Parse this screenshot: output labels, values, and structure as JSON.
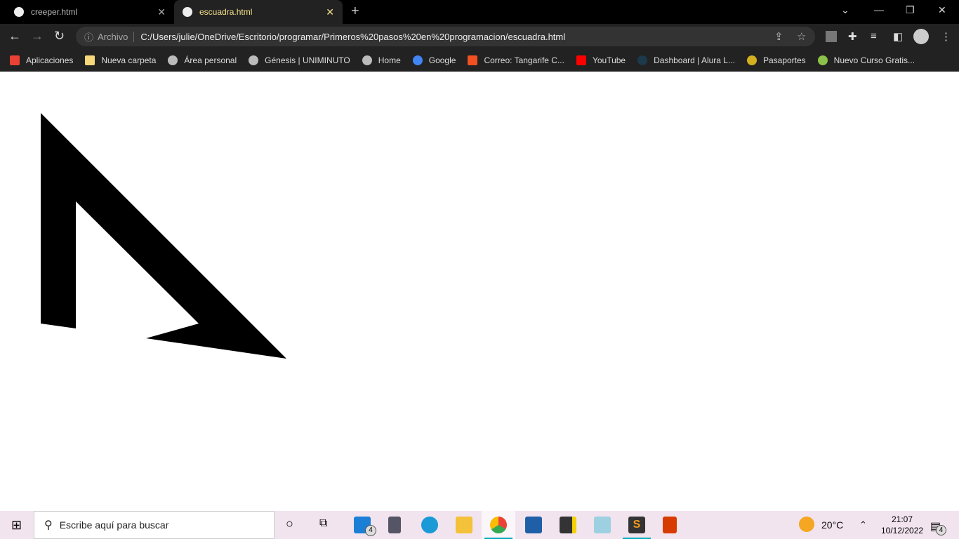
{
  "tabs": [
    {
      "title": "creeper.html",
      "active": false
    },
    {
      "title": "escuadra.html",
      "active": true
    }
  ],
  "omnibox": {
    "security_label": "Archivo",
    "url": "C:/Users/julie/OneDrive/Escritorio/programar/Primeros%20pasos%20en%20programacion/escuadra.html"
  },
  "bookmarks": [
    {
      "label": "Aplicaciones",
      "icon": "apps-grid-icon",
      "color": "#e94235"
    },
    {
      "label": "Nueva carpeta",
      "icon": "folder-icon",
      "color": "#f6d77a"
    },
    {
      "label": "Área personal",
      "icon": "globe-icon",
      "color": "#bbbbbb"
    },
    {
      "label": "Génesis | UNIMINUTO",
      "icon": "globe-icon",
      "color": "#bbbbbb"
    },
    {
      "label": "Home",
      "icon": "globe-icon",
      "color": "#bbbbbb"
    },
    {
      "label": "Google",
      "icon": "google-icon",
      "color": "#4285f4"
    },
    {
      "label": "Correo: Tangarife C...",
      "icon": "microsoft-icon",
      "color": "#f25022"
    },
    {
      "label": "YouTube",
      "icon": "youtube-icon",
      "color": "#ff0000"
    },
    {
      "label": "Dashboard | Alura L...",
      "icon": "alura-icon",
      "color": "#1c3a4a"
    },
    {
      "label": "Pasaportes",
      "icon": "shield-icon",
      "color": "#d4b020"
    },
    {
      "label": "Nuevo Curso Gratis...",
      "icon": "diamond-icon",
      "color": "#8bc34a"
    }
  ],
  "canvas": {
    "shape_color": "#000000"
  },
  "taskbar": {
    "search_placeholder": "Escribe aquí para buscar",
    "mail_badge": "4",
    "weather": "20°C",
    "time": "21:07",
    "date": "10/12/2022",
    "notification_badge": "4"
  }
}
